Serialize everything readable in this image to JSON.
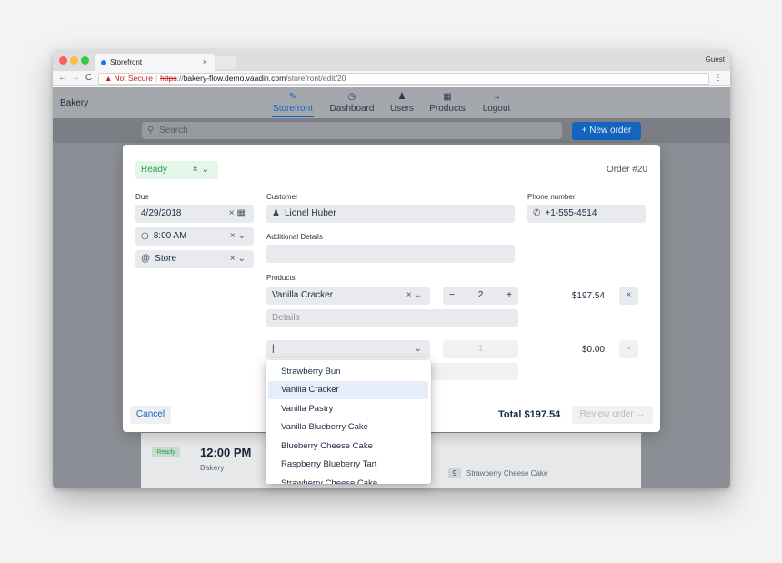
{
  "browser": {
    "tab_title": "Storefront",
    "tab_close": "×",
    "profile": "Guest",
    "back": "←",
    "forward": "→",
    "reload": "C",
    "warning_icon": "▲",
    "security_label": "Not Secure",
    "url_scheme": "https",
    "url_scheme_sep": "://",
    "url_host": "bakery-flow.demo.vaadin.com",
    "url_path": "/storefront/edit/20",
    "menu": "⋮"
  },
  "header": {
    "brand": "Bakery",
    "nav": [
      {
        "label": "Storefront",
        "icon": "✎"
      },
      {
        "label": "Dashboard",
        "icon": "◷"
      },
      {
        "label": "Users",
        "icon": "♟"
      },
      {
        "label": "Products",
        "icon": "▦"
      },
      {
        "label": "Logout",
        "icon": "→"
      }
    ]
  },
  "search": {
    "icon": "🔍",
    "placeholder": "Search",
    "new_order": "+ New order"
  },
  "background_order": {
    "status": "Ready",
    "time": "12:00 PM",
    "location": "Bakery",
    "product_qty": "9",
    "product_name": "Strawberry Cheese Cake"
  },
  "dialog": {
    "status": "Ready",
    "status_clear": "×",
    "chevron": "⌄",
    "order_number": "Order #20",
    "due_label": "Due",
    "due_date": "4/29/2018",
    "clear": "×",
    "calendar_icon": "▦",
    "time_icon": "◷",
    "due_time": "8:00 AM",
    "location_icon": "@",
    "location": "Store",
    "customer_label": "Customer",
    "customer_icon": "♟",
    "customer": "Lionel Huber",
    "phone_label": "Phone number",
    "phone_icon": "✆",
    "phone": "+1-555-4514",
    "additional_label": "Additional Details",
    "products_label": "Products",
    "product_1": {
      "name": "Vanilla Cracker",
      "minus": "−",
      "quantity": "2",
      "plus": "+",
      "price": "$197.54",
      "remove": "×",
      "details_placeholder": "Details"
    },
    "product_2": {
      "name": "|",
      "quantity": "1",
      "price": "$0.00",
      "remove": "×"
    },
    "cancel": "Cancel",
    "total": "Total $197.54",
    "review": "Review order →"
  },
  "dropdown": {
    "items": [
      "Strawberry Bun",
      "Vanilla Cracker",
      "Vanilla Pastry",
      "Vanilla Blueberry Cake",
      "Blueberry Cheese Cake",
      "Raspberry Blueberry Tart",
      "Strawberry Cheese Cake"
    ]
  }
}
